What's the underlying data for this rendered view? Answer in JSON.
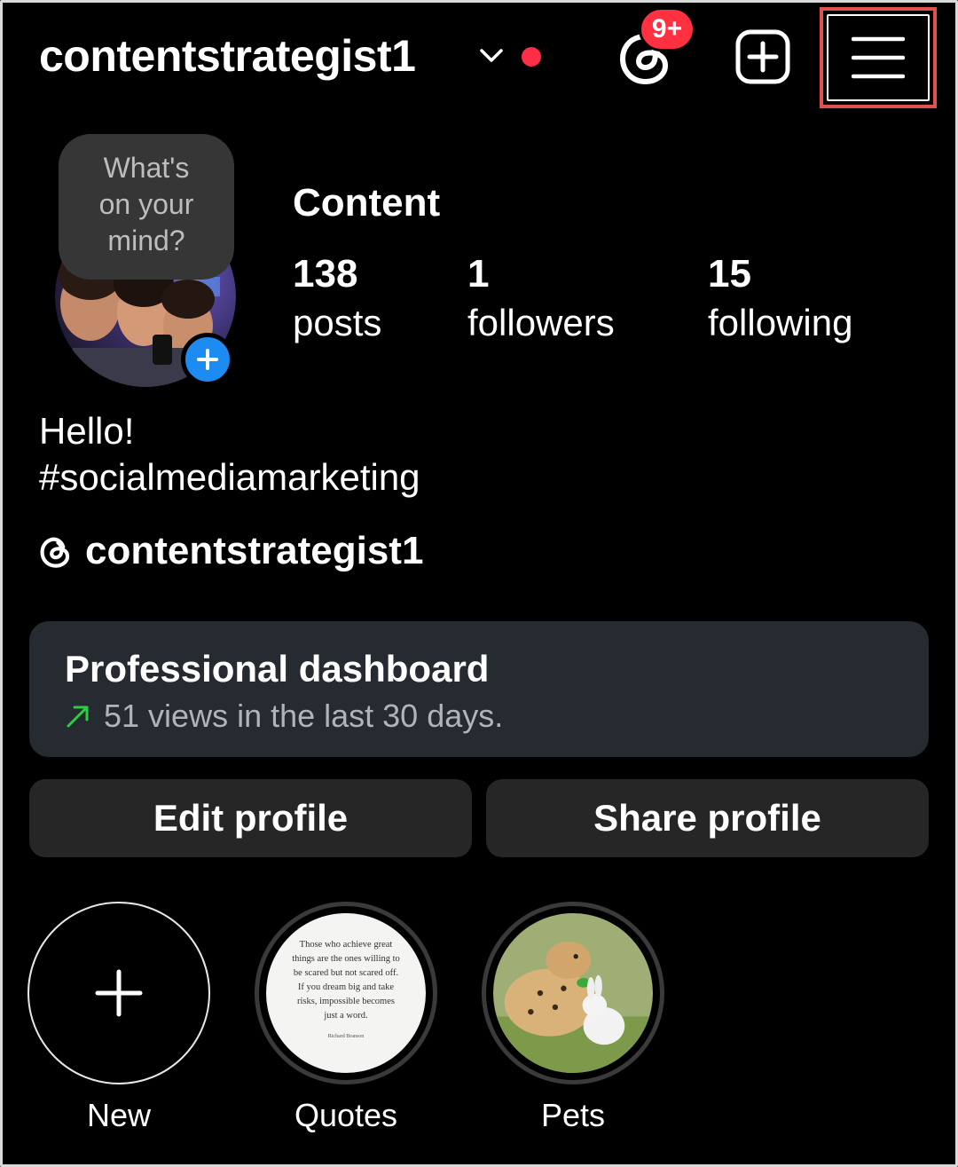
{
  "header": {
    "username": "contentstrategist1",
    "notification_badge": "9+",
    "accent_red": "#ff3040",
    "highlight_box_color": "#e15151"
  },
  "note": {
    "text_line1": "What's",
    "text_line2": "on your",
    "text_line3": "mind?"
  },
  "profile": {
    "name": "Content",
    "stats": {
      "posts": {
        "value": "138",
        "label": "posts"
      },
      "followers": {
        "value": "1",
        "label": "followers"
      },
      "following": {
        "value": "15",
        "label": "following"
      }
    },
    "bio_line1": "Hello!",
    "bio_line2": "#socialmediamarketing",
    "threads_handle": "contentstrategist1"
  },
  "dashboard": {
    "title": "Professional dashboard",
    "subtitle": "51 views in the last 30 days.",
    "trend_color": "#2ecc40"
  },
  "buttons": {
    "edit": "Edit profile",
    "share": "Share profile"
  },
  "highlights": [
    {
      "label": "New",
      "icon": "plus-icon"
    },
    {
      "label": "Quotes",
      "quote_lines": [
        "Those who achieve great",
        "things are the ones willing to",
        "be scared but not scared off.",
        "If you dream big and take",
        "risks, impossible becomes",
        "just a word."
      ],
      "quote_author": "Richard Branson"
    },
    {
      "label": "Pets"
    }
  ]
}
